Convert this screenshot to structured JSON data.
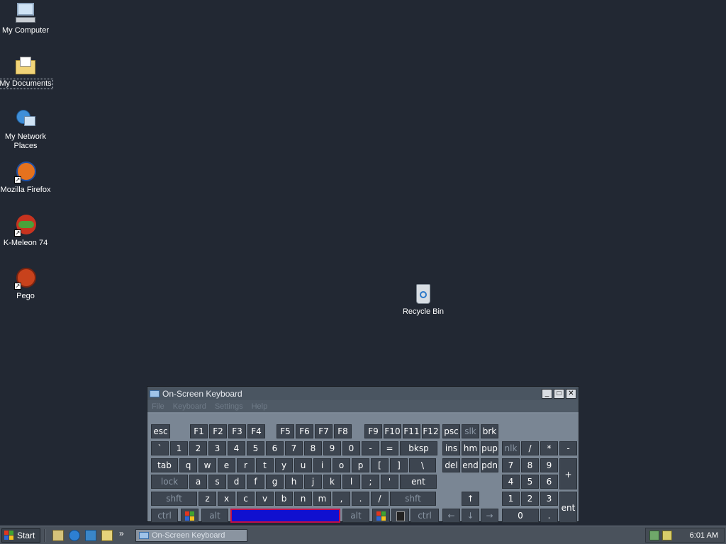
{
  "desktop": {
    "icons": [
      {
        "label": "My Computer"
      },
      {
        "label": "My Documents"
      },
      {
        "label": "My Network Places"
      },
      {
        "label": "Mozilla Firefox"
      },
      {
        "label": "K-Meleon 74"
      },
      {
        "label": "Pego"
      },
      {
        "label": "Recycle Bin"
      }
    ]
  },
  "osk": {
    "title": "On-Screen Keyboard",
    "menu": [
      "File",
      "Keyboard",
      "Settings",
      "Help"
    ],
    "rows": {
      "fn": [
        "esc",
        "F1",
        "F2",
        "F3",
        "F4",
        "F5",
        "F6",
        "F7",
        "F8",
        "F9",
        "F10",
        "F11",
        "F12",
        "psc",
        "slk",
        "brk"
      ],
      "num": [
        "`",
        "1",
        "2",
        "3",
        "4",
        "5",
        "6",
        "7",
        "8",
        "9",
        "0",
        "-",
        "=",
        "bksp",
        "ins",
        "hm",
        "pup",
        "nlk",
        "/",
        "*",
        "-"
      ],
      "top": [
        "tab",
        "q",
        "w",
        "e",
        "r",
        "t",
        "y",
        "u",
        "i",
        "o",
        "p",
        "[",
        "]",
        "\\",
        "del",
        "end",
        "pdn",
        "7",
        "8",
        "9",
        "+"
      ],
      "home": [
        "lock",
        "a",
        "s",
        "d",
        "f",
        "g",
        "h",
        "j",
        "k",
        "l",
        ";",
        "'",
        "ent",
        "4",
        "5",
        "6"
      ],
      "bottom": [
        "shft",
        "z",
        "x",
        "c",
        "v",
        "b",
        "n",
        "m",
        ",",
        ".",
        "/",
        "shft",
        "↑",
        "1",
        "2",
        "3",
        "ent"
      ],
      "space": [
        "ctrl",
        "alt",
        "alt",
        "ctrl",
        "←",
        "↓",
        "→",
        "0",
        "."
      ]
    }
  },
  "taskbar": {
    "start_label": "Start",
    "task_label": "On-Screen Keyboard",
    "overflow": "»",
    "clock": "6:01 AM"
  }
}
